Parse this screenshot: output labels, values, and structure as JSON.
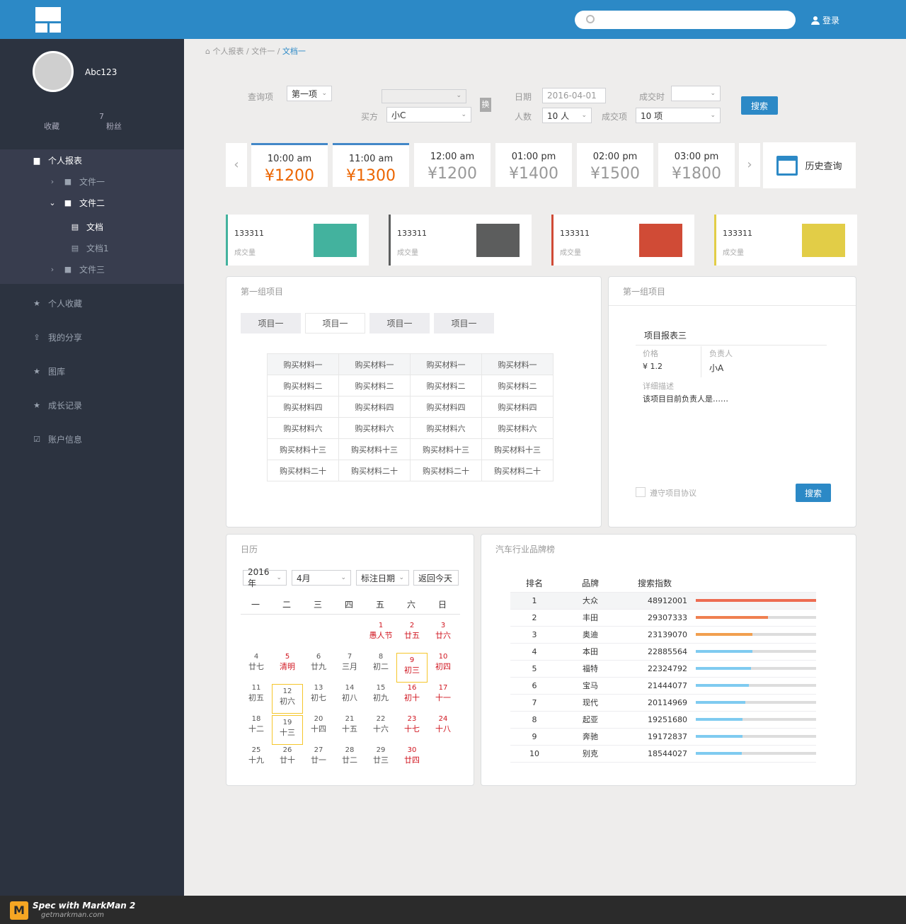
{
  "header": {
    "login_label": "登录",
    "search_placeholder": ""
  },
  "user": {
    "name": "Abc123",
    "stats": [
      {
        "label": "收藏",
        "value": ""
      },
      {
        "label": "粉丝",
        "value": "7"
      }
    ]
  },
  "sidebar": {
    "items": [
      {
        "label": "个人报表",
        "icon": "report-icon"
      },
      {
        "label": "文件一"
      },
      {
        "label": "文件二"
      },
      {
        "label": "文档"
      },
      {
        "label": "文档1"
      },
      {
        "label": "文件三"
      },
      {
        "label": "个人收藏",
        "icon": "star-icon"
      },
      {
        "label": "我的分享",
        "icon": "share-icon"
      },
      {
        "label": "图库",
        "icon": "star-icon"
      },
      {
        "label": "成长记录",
        "icon": "star-icon"
      },
      {
        "label": "账户信息",
        "icon": "account-icon"
      }
    ]
  },
  "breadcrumb": {
    "items": [
      "个人报表",
      "文件一",
      "文档一"
    ],
    "separator": "/"
  },
  "query": {
    "label_query": "查询项",
    "select_query": "第一项",
    "label_buy": "买方",
    "select_buy": "小C",
    "swap_label": "换",
    "label_date": "日期",
    "date_value": "2016-04-01",
    "label_people": "人数",
    "select_people": "10 人",
    "label_deal_time": "成交时",
    "label_deal_item": "成交项",
    "select_deal": "10 项",
    "search_label": "搜索"
  },
  "timeslots": {
    "slots": [
      {
        "time": "10:00 am",
        "price": "¥1200"
      },
      {
        "time": "11:00 am",
        "price": "¥1300"
      },
      {
        "time": "12:00 am",
        "price": "¥1200"
      },
      {
        "time": "01:00 pm",
        "price": "¥1400"
      },
      {
        "time": "02:00 pm",
        "price": "¥1500"
      },
      {
        "time": "03:00 pm",
        "price": "¥1800"
      }
    ],
    "history_label": "历史查询"
  },
  "kpis": [
    {
      "value": "133311",
      "label": "成交量",
      "color": "#43b29e"
    },
    {
      "value": "133311",
      "label": "成交量",
      "color": "#5c5d5d"
    },
    {
      "value": "133311",
      "label": "成交量",
      "color": "#d04b36"
    },
    {
      "value": "133311",
      "label": "成交量",
      "color": "#e2cd47"
    }
  ],
  "group1": {
    "title": "第一组项目",
    "tabs": [
      "项目一",
      "项目一",
      "项目一",
      "项目一"
    ],
    "rows": [
      [
        "购买材料一",
        "购买材料一",
        "购买材料一",
        "购买材料一"
      ],
      [
        "购买材料二",
        "购买材料二",
        "购买材料二",
        "购买材料二"
      ],
      [
        "购买材料四",
        "购买材料四",
        "购买材料四",
        "购买材料四"
      ],
      [
        "购买材料六",
        "购买材料六",
        "购买材料六",
        "购买材料六"
      ],
      [
        "购买材料十三",
        "购买材料十三",
        "购买材料十三",
        "购买材料十三"
      ],
      [
        "购买材料二十",
        "购买材料二十",
        "购买材料二十",
        "购买材料二十"
      ]
    ]
  },
  "group2": {
    "title": "第一组项目",
    "project": "项目报表三",
    "price_label": "价格",
    "price_value": "¥ 1.2",
    "owner_label": "负责人",
    "owner_value": "小A",
    "desc_label": "详细描述",
    "desc_value": "该项目目前负责人是……",
    "agree_label": "遵守项目协议",
    "search_label": "搜索"
  },
  "calendar": {
    "title": "日历",
    "year": "2016年",
    "month": "4月",
    "mark": "标注日期",
    "back": "返回今天",
    "weekdays": [
      "一",
      "二",
      "三",
      "四",
      "五",
      "六",
      "日"
    ],
    "days": [
      {
        "d": "1",
        "l": "愚人节",
        "red": true,
        "col": 4,
        "row": 0
      },
      {
        "d": "2",
        "l": "廿五",
        "red": true,
        "col": 5,
        "row": 0
      },
      {
        "d": "3",
        "l": "廿六",
        "red": true,
        "col": 6,
        "row": 0
      },
      {
        "d": "4",
        "l": "廿七",
        "col": 0,
        "row": 1
      },
      {
        "d": "5",
        "l": "清明",
        "red": true,
        "col": 1,
        "row": 1
      },
      {
        "d": "6",
        "l": "廿九",
        "col": 2,
        "row": 1
      },
      {
        "d": "7",
        "l": "三月",
        "col": 3,
        "row": 1
      },
      {
        "d": "8",
        "l": "初二",
        "col": 4,
        "row": 1
      },
      {
        "d": "9",
        "l": "初三",
        "red": true,
        "col": 5,
        "row": 1,
        "box": true
      },
      {
        "d": "10",
        "l": "初四",
        "red": true,
        "col": 6,
        "row": 1
      },
      {
        "d": "11",
        "l": "初五",
        "col": 0,
        "row": 2
      },
      {
        "d": "12",
        "l": "初六",
        "col": 1,
        "row": 2,
        "box": true
      },
      {
        "d": "13",
        "l": "初七",
        "col": 2,
        "row": 2
      },
      {
        "d": "14",
        "l": "初八",
        "col": 3,
        "row": 2
      },
      {
        "d": "15",
        "l": "初九",
        "col": 4,
        "row": 2
      },
      {
        "d": "16",
        "l": "初十",
        "red": true,
        "col": 5,
        "row": 2
      },
      {
        "d": "17",
        "l": "十一",
        "red": true,
        "col": 6,
        "row": 2
      },
      {
        "d": "18",
        "l": "十二",
        "col": 0,
        "row": 3
      },
      {
        "d": "19",
        "l": "十三",
        "col": 1,
        "row": 3,
        "box": true
      },
      {
        "d": "20",
        "l": "十四",
        "col": 2,
        "row": 3
      },
      {
        "d": "21",
        "l": "十五",
        "col": 3,
        "row": 3
      },
      {
        "d": "22",
        "l": "十六",
        "col": 4,
        "row": 3
      },
      {
        "d": "23",
        "l": "十七",
        "red": true,
        "col": 5,
        "row": 3
      },
      {
        "d": "24",
        "l": "十八",
        "red": true,
        "col": 6,
        "row": 3
      },
      {
        "d": "25",
        "l": "十九",
        "col": 0,
        "row": 4
      },
      {
        "d": "26",
        "l": "廿十",
        "col": 1,
        "row": 4
      },
      {
        "d": "27",
        "l": "廿一",
        "col": 2,
        "row": 4
      },
      {
        "d": "28",
        "l": "廿二",
        "col": 3,
        "row": 4
      },
      {
        "d": "29",
        "l": "廿三",
        "col": 4,
        "row": 4
      },
      {
        "d": "30",
        "l": "廿四",
        "red": true,
        "col": 5,
        "row": 4
      }
    ]
  },
  "ranking": {
    "title": "汽车行业品牌榜",
    "headers": [
      "排名",
      "品牌",
      "搜索指数"
    ],
    "rows": [
      {
        "rank": "1",
        "brand": "大众",
        "index": "48912001",
        "pct": 100,
        "color": "#ed6c52"
      },
      {
        "rank": "2",
        "brand": "丰田",
        "index": "29307333",
        "pct": 60,
        "color": "#ef8050"
      },
      {
        "rank": "3",
        "brand": "奥迪",
        "index": "23139070",
        "pct": 47,
        "color": "#f19f4f"
      },
      {
        "rank": "4",
        "brand": "本田",
        "index": "22885564",
        "pct": 47,
        "color": "#7fcbf0"
      },
      {
        "rank": "5",
        "brand": "福特",
        "index": "22324792",
        "pct": 46,
        "color": "#7fcbf0"
      },
      {
        "rank": "6",
        "brand": "宝马",
        "index": "21444077",
        "pct": 44,
        "color": "#7fcbf0"
      },
      {
        "rank": "7",
        "brand": "现代",
        "index": "20114969",
        "pct": 41,
        "color": "#7fcbf0"
      },
      {
        "rank": "8",
        "brand": "起亚",
        "index": "19251680",
        "pct": 39,
        "color": "#7fcbf0"
      },
      {
        "rank": "9",
        "brand": "奔驰",
        "index": "19172837",
        "pct": 39,
        "color": "#7fcbf0"
      },
      {
        "rank": "10",
        "brand": "别克",
        "index": "18544027",
        "pct": 38,
        "color": "#7fcbf0"
      }
    ]
  },
  "footer": {
    "brand": "Spec with MarkMan 2",
    "url": "getmarkman.com"
  }
}
